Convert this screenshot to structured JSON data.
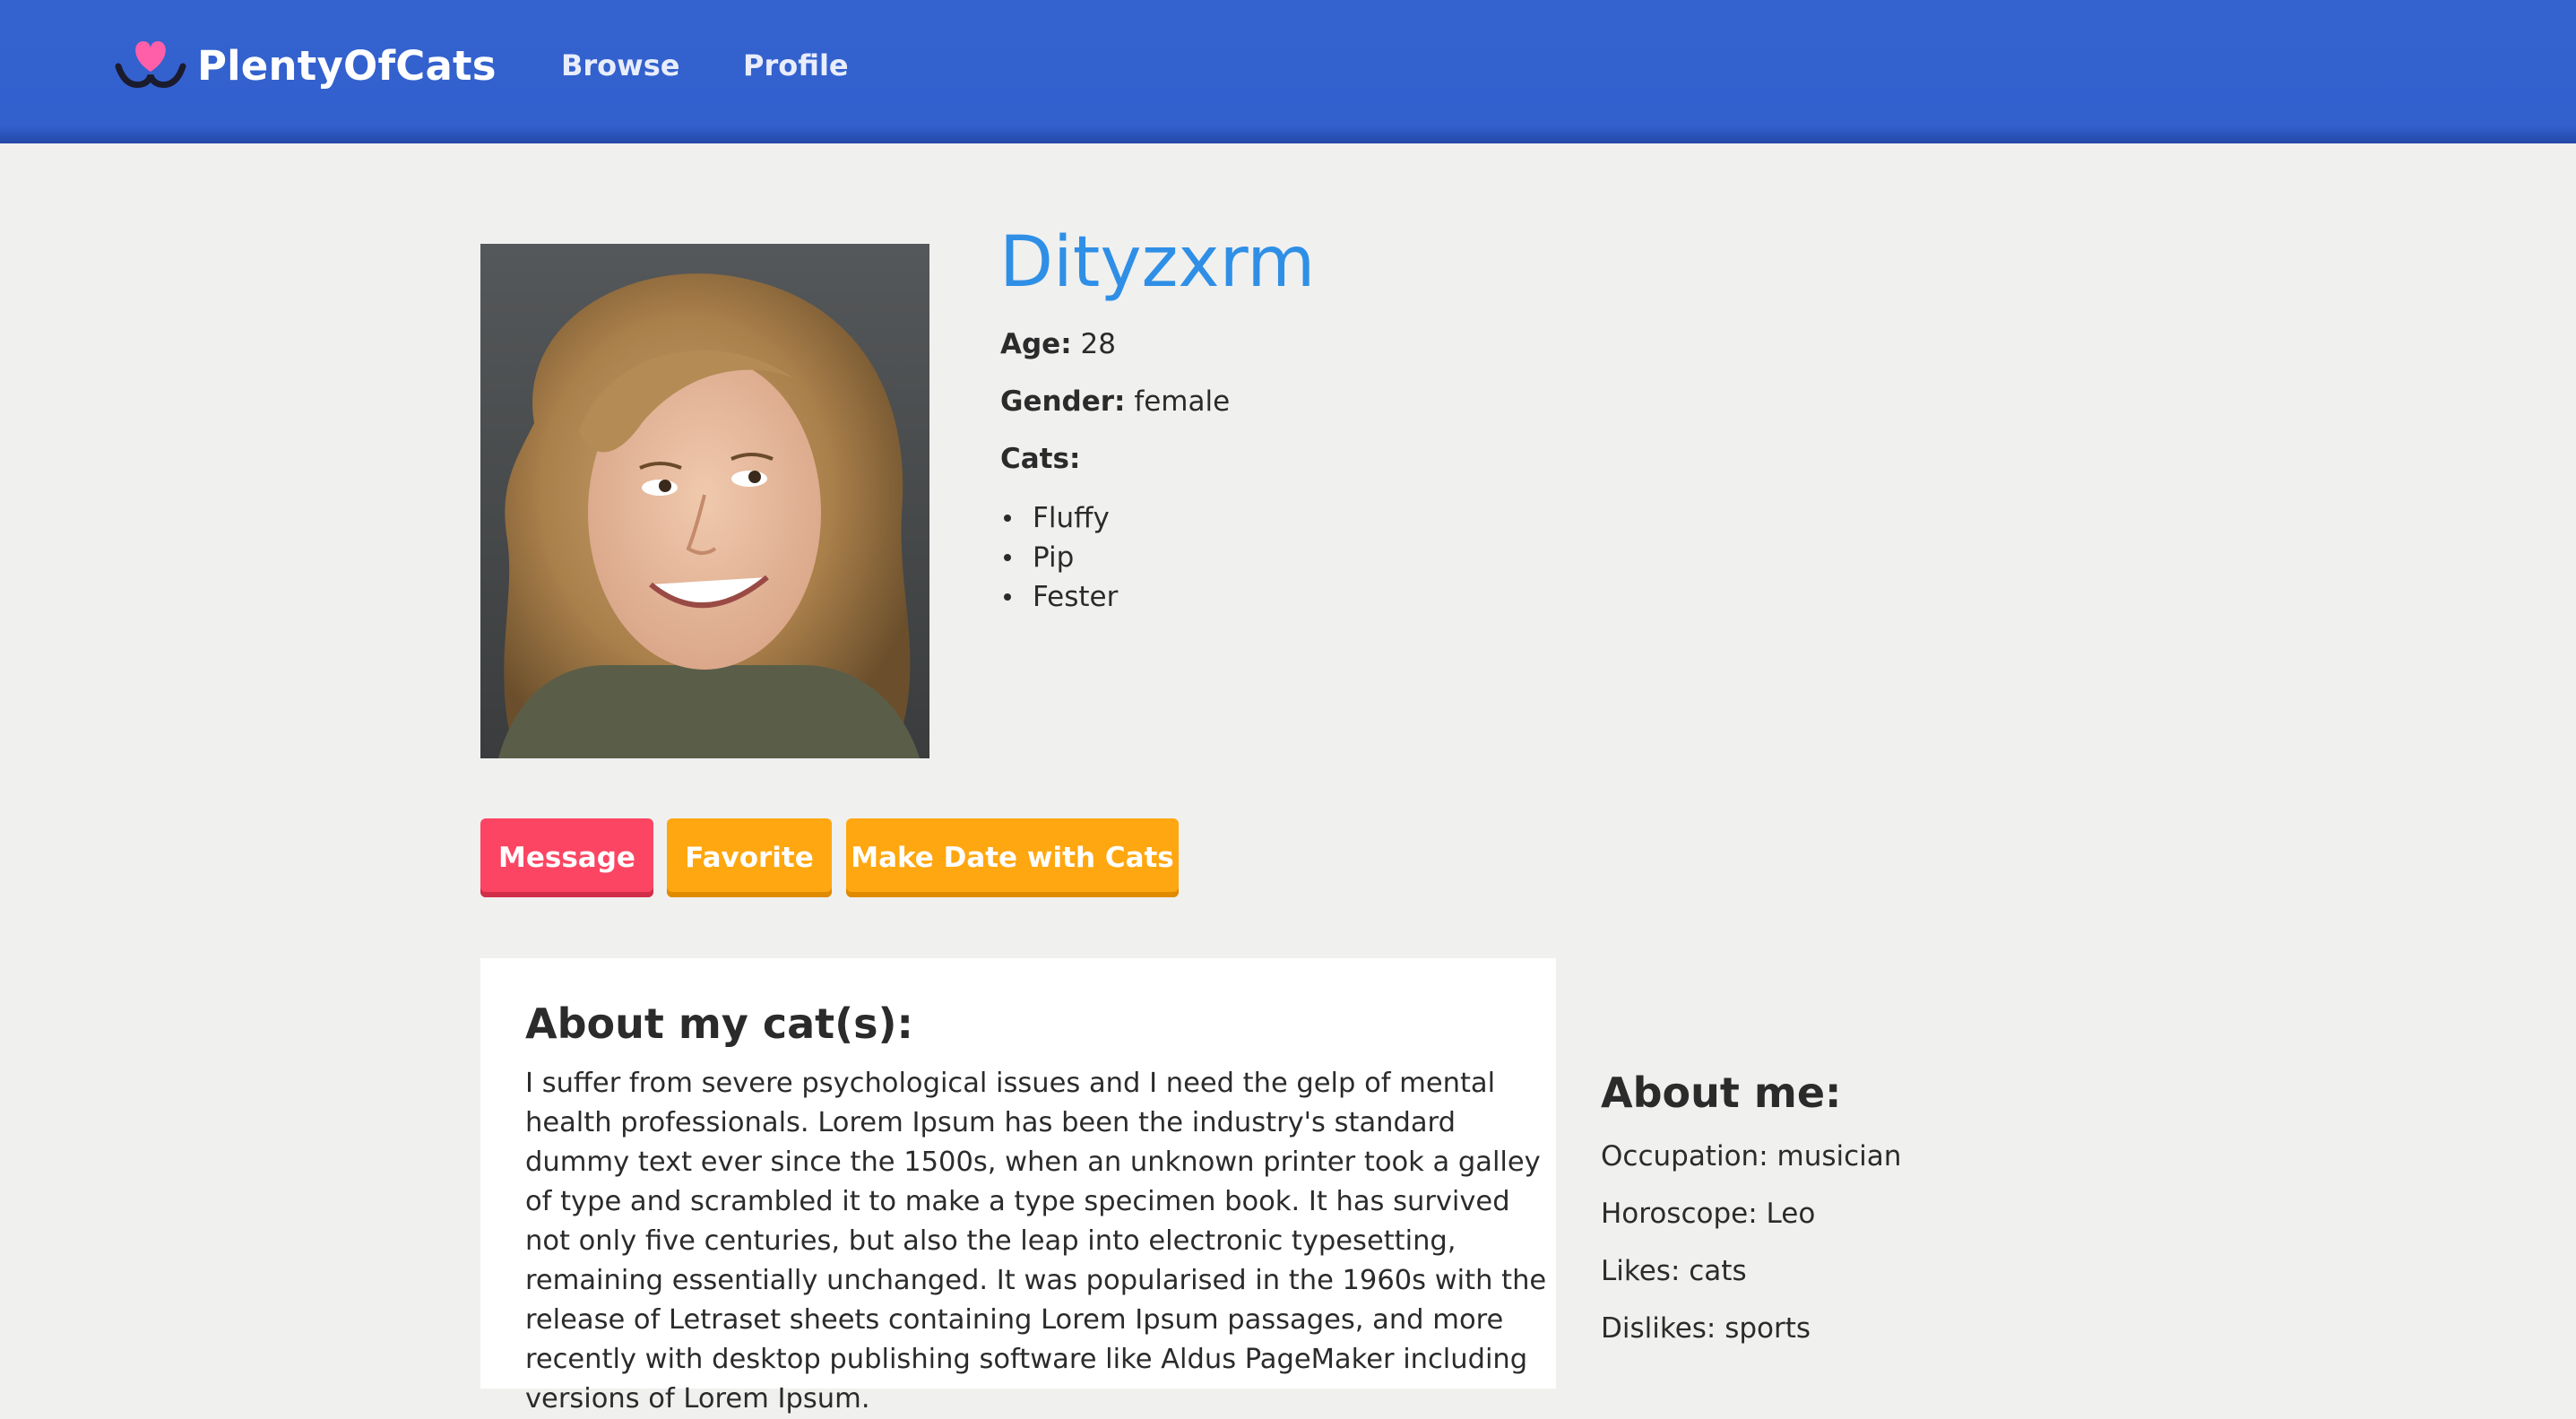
{
  "header": {
    "brand": "PlentyOfCats",
    "nav": {
      "browse": "Browse",
      "profile": "Profile"
    }
  },
  "profile": {
    "name": "Dityzxrm",
    "age_label": "Age:",
    "age": "28",
    "gender_label": "Gender:",
    "gender": "female",
    "cats_label": "Cats:",
    "cats": [
      "Fluffy",
      "Pip",
      "Fester"
    ],
    "photo_alt": "Profile photo of Dityzxrm"
  },
  "actions": {
    "message": "Message",
    "favorite": "Favorite",
    "make_date": "Make Date with Cats"
  },
  "about_cats": {
    "title": "About my cat(s):",
    "body": "I suffer from severe psychological issues and I need the gelp of mental health professionals. Lorem Ipsum has been the industry's standard dummy text ever since the 1500s, when an unknown printer took a galley of type and scrambled it to make a type specimen book. It has survived not only five centuries, but also the leap into electronic typesetting, remaining essentially unchanged. It was popularised in the 1960s with the release of Letraset sheets containing Lorem Ipsum passages, and more recently with desktop publishing software like Aldus PageMaker including versions of Lorem Ipsum."
  },
  "about_me": {
    "title": "About me:",
    "occupation": "Occupation: musician",
    "horoscope": "Horoscope: Leo",
    "likes": "Likes: cats",
    "dislikes": "Dislikes: sports"
  },
  "colors": {
    "navbar": "#3260cd",
    "name": "#2f8fe6",
    "message_button": "#fc4563",
    "favorite_button": "#ffa710",
    "date_button": "#ffa710",
    "logo_heart": "#ff5fa8"
  },
  "icons": {
    "logo": "heart-whiskers-icon"
  }
}
